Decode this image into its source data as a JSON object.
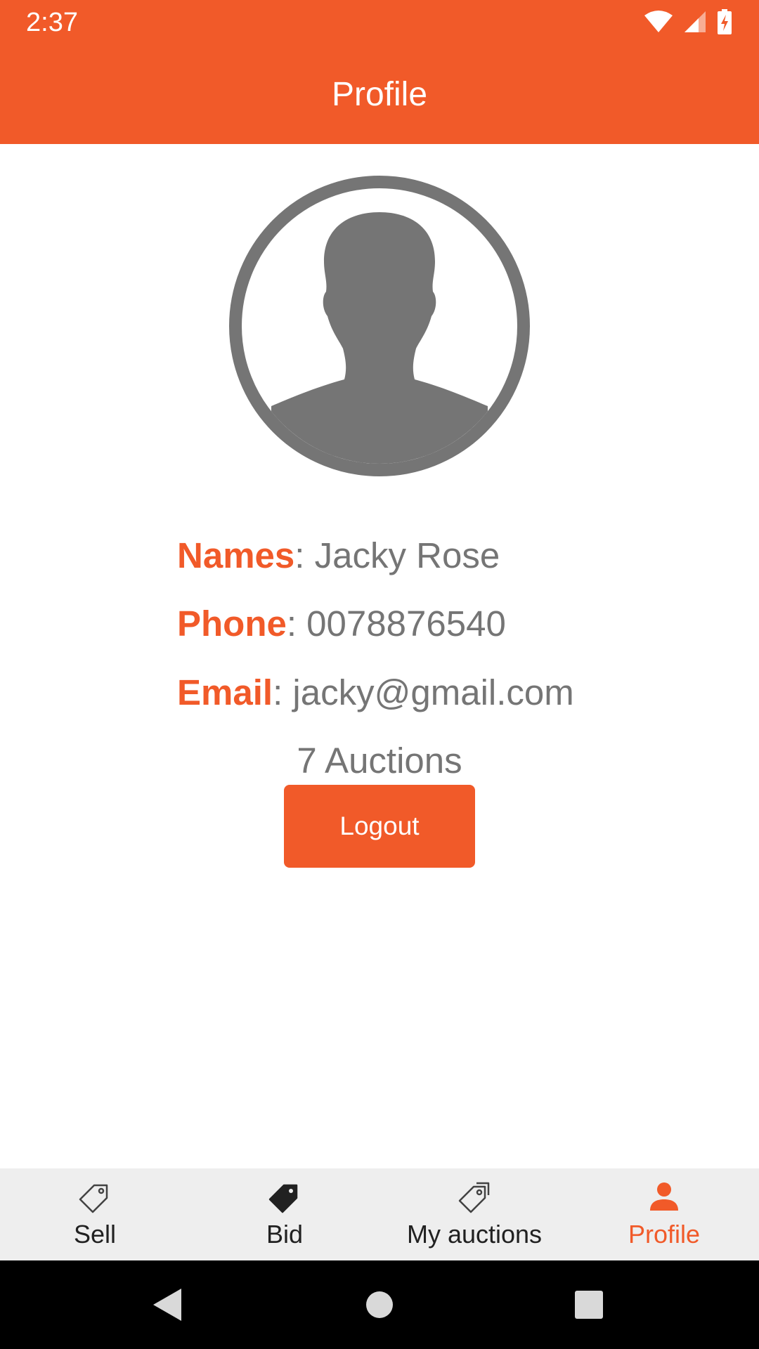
{
  "status_bar": {
    "time": "2:37",
    "icons": [
      "wifi-icon",
      "cell-signal-icon",
      "battery-charging-icon"
    ]
  },
  "app_bar": {
    "title": "Profile",
    "color": "#f15a29"
  },
  "profile": {
    "avatar_icon": "person-silhouette-icon",
    "name_label": "Names",
    "name_value": ": Jacky Rose",
    "phone_label": "Phone",
    "phone_value": ": 0078876540",
    "email_label": "Email",
    "email_value": ": jacky@gmail.com",
    "auctions_count": "7 Auctions",
    "logout_label": "Logout"
  },
  "bottom_nav": {
    "items": [
      {
        "label": "Sell",
        "icon": "tag-outline-icon",
        "active": false
      },
      {
        "label": "Bid",
        "icon": "tag-filled-icon",
        "active": false
      },
      {
        "label": "My auctions",
        "icon": "tags-outline-icon",
        "active": false
      },
      {
        "label": "Profile",
        "icon": "person-icon",
        "active": true
      }
    ],
    "active_color": "#f15a29",
    "background": "#eeeeee"
  },
  "system_nav": {
    "buttons": [
      "back-icon",
      "home-icon",
      "recents-icon"
    ]
  },
  "colors": {
    "accent": "#f15a29",
    "text_gray": "#757575",
    "avatar_gray": "#757575"
  }
}
